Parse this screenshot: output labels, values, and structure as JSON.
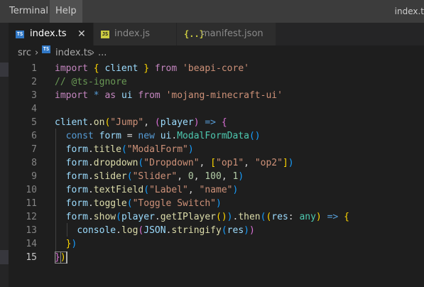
{
  "menubar": {
    "items": [
      {
        "label": "Terminal",
        "active": false
      },
      {
        "label": "Help",
        "active": true
      }
    ],
    "window_title": "index.t"
  },
  "tabs": [
    {
      "label": "index.ts",
      "icon": "ts-file-icon",
      "icon_text": "TS",
      "active": true,
      "closable": true,
      "close_glyph": "✕"
    },
    {
      "label": "index.js",
      "icon": "js-file-icon",
      "icon_text": "JS",
      "active": false
    },
    {
      "label": "manifest.json",
      "icon": "json-file-icon",
      "icon_text": "{..}",
      "active": false
    }
  ],
  "breadcrumb": {
    "folder": "src",
    "separator": "›",
    "file": "index.ts",
    "file_icon_text": "TS",
    "tail": "..."
  },
  "editor": {
    "current_line": 15,
    "colors": {
      "keyword": "#569cd6",
      "control": "#c586c0",
      "string": "#ce9178",
      "comment": "#6a9955",
      "variable": "#9cdcfe",
      "function": "#dcdcaa",
      "class": "#4ec9b0",
      "number": "#b5cea8"
    },
    "lines": [
      {
        "num": "1",
        "tokens": [
          [
            "tok-kw-ctl",
            "import"
          ],
          [
            "tok-plain",
            " "
          ],
          [
            "tok-br1",
            "{"
          ],
          [
            "tok-plain",
            " "
          ],
          [
            "tok-var",
            "client"
          ],
          [
            "tok-plain",
            " "
          ],
          [
            "tok-br1",
            "}"
          ],
          [
            "tok-plain",
            " "
          ],
          [
            "tok-kw-ctl",
            "from"
          ],
          [
            "tok-plain",
            " "
          ],
          [
            "tok-str",
            "'beapi-core'"
          ]
        ]
      },
      {
        "num": "2",
        "tokens": [
          [
            "tok-cmt",
            "// @ts-ignore"
          ]
        ]
      },
      {
        "num": "3",
        "tokens": [
          [
            "tok-kw-ctl",
            "import"
          ],
          [
            "tok-plain",
            " "
          ],
          [
            "tok-kw-blue",
            "*"
          ],
          [
            "tok-plain",
            " "
          ],
          [
            "tok-kw-ctl",
            "as"
          ],
          [
            "tok-plain",
            " "
          ],
          [
            "tok-var",
            "ui"
          ],
          [
            "tok-plain",
            " "
          ],
          [
            "tok-kw-ctl",
            "from"
          ],
          [
            "tok-plain",
            " "
          ],
          [
            "tok-str",
            "'mojang-minecraft-ui'"
          ]
        ]
      },
      {
        "num": "4",
        "tokens": []
      },
      {
        "num": "5",
        "tokens": [
          [
            "tok-var",
            "client"
          ],
          [
            "tok-plain",
            "."
          ],
          [
            "tok-fn",
            "on"
          ],
          [
            "tok-br1",
            "("
          ],
          [
            "tok-str",
            "\"Jump\""
          ],
          [
            "tok-plain",
            ", "
          ],
          [
            "tok-br2",
            "("
          ],
          [
            "tok-var",
            "player"
          ],
          [
            "tok-br2",
            ")"
          ],
          [
            "tok-plain",
            " "
          ],
          [
            "tok-kw-blue",
            "=>"
          ],
          [
            "tok-plain",
            " "
          ],
          [
            "tok-br2",
            "{"
          ]
        ]
      },
      {
        "num": "6",
        "tokens": [
          [
            "tok-plain",
            "  "
          ],
          [
            "tok-kw-blue",
            "const"
          ],
          [
            "tok-plain",
            " "
          ],
          [
            "tok-var",
            "form"
          ],
          [
            "tok-plain",
            " = "
          ],
          [
            "tok-kw-blue",
            "new"
          ],
          [
            "tok-plain",
            " "
          ],
          [
            "tok-var",
            "ui"
          ],
          [
            "tok-plain",
            "."
          ],
          [
            "tok-cls",
            "ModalFormData"
          ],
          [
            "tok-br3",
            "()"
          ]
        ]
      },
      {
        "num": "7",
        "tokens": [
          [
            "tok-plain",
            "  "
          ],
          [
            "tok-var",
            "form"
          ],
          [
            "tok-plain",
            "."
          ],
          [
            "tok-fn",
            "title"
          ],
          [
            "tok-br3",
            "("
          ],
          [
            "tok-str",
            "\"ModalForm\""
          ],
          [
            "tok-br3",
            ")"
          ]
        ]
      },
      {
        "num": "8",
        "tokens": [
          [
            "tok-plain",
            "  "
          ],
          [
            "tok-var",
            "form"
          ],
          [
            "tok-plain",
            "."
          ],
          [
            "tok-fn",
            "dropdown"
          ],
          [
            "tok-br3",
            "("
          ],
          [
            "tok-str",
            "\"Dropdown\""
          ],
          [
            "tok-plain",
            ", "
          ],
          [
            "tok-br1",
            "["
          ],
          [
            "tok-str",
            "\"op1\""
          ],
          [
            "tok-plain",
            ", "
          ],
          [
            "tok-str",
            "\"op2\""
          ],
          [
            "tok-br1",
            "]"
          ],
          [
            "tok-br3",
            ")"
          ]
        ]
      },
      {
        "num": "9",
        "tokens": [
          [
            "tok-plain",
            "  "
          ],
          [
            "tok-var",
            "form"
          ],
          [
            "tok-plain",
            "."
          ],
          [
            "tok-fn",
            "slider"
          ],
          [
            "tok-br3",
            "("
          ],
          [
            "tok-str",
            "\"Slider\""
          ],
          [
            "tok-plain",
            ", "
          ],
          [
            "tok-num",
            "0"
          ],
          [
            "tok-plain",
            ", "
          ],
          [
            "tok-num",
            "100"
          ],
          [
            "tok-plain",
            ", "
          ],
          [
            "tok-num",
            "1"
          ],
          [
            "tok-br3",
            ")"
          ]
        ]
      },
      {
        "num": "10",
        "tokens": [
          [
            "tok-plain",
            "  "
          ],
          [
            "tok-var",
            "form"
          ],
          [
            "tok-plain",
            "."
          ],
          [
            "tok-fn",
            "textField"
          ],
          [
            "tok-br3",
            "("
          ],
          [
            "tok-str",
            "\"Label\""
          ],
          [
            "tok-plain",
            ", "
          ],
          [
            "tok-str",
            "\"name\""
          ],
          [
            "tok-br3",
            ")"
          ]
        ]
      },
      {
        "num": "11",
        "tokens": [
          [
            "tok-plain",
            "  "
          ],
          [
            "tok-var",
            "form"
          ],
          [
            "tok-plain",
            "."
          ],
          [
            "tok-fn",
            "toggle"
          ],
          [
            "tok-br3",
            "("
          ],
          [
            "tok-str",
            "\"Toggle Switch\""
          ],
          [
            "tok-br3",
            ")"
          ]
        ]
      },
      {
        "num": "12",
        "tokens": [
          [
            "tok-plain",
            "  "
          ],
          [
            "tok-var",
            "form"
          ],
          [
            "tok-plain",
            "."
          ],
          [
            "tok-fn",
            "show"
          ],
          [
            "tok-br3",
            "("
          ],
          [
            "tok-var",
            "player"
          ],
          [
            "tok-plain",
            "."
          ],
          [
            "tok-fn",
            "getIPlayer"
          ],
          [
            "tok-br1",
            "()"
          ],
          [
            "tok-br3",
            ")"
          ],
          [
            "tok-plain",
            "."
          ],
          [
            "tok-fn",
            "then"
          ],
          [
            "tok-br3",
            "("
          ],
          [
            "tok-br1",
            "("
          ],
          [
            "tok-var",
            "res"
          ],
          [
            "tok-plain",
            ": "
          ],
          [
            "tok-type",
            "any"
          ],
          [
            "tok-br1",
            ")"
          ],
          [
            "tok-plain",
            " "
          ],
          [
            "tok-kw-blue",
            "=>"
          ],
          [
            "tok-plain",
            " "
          ],
          [
            "tok-br1",
            "{"
          ]
        ]
      },
      {
        "num": "13",
        "tokens": [
          [
            "tok-plain",
            "    "
          ],
          [
            "tok-var",
            "console"
          ],
          [
            "tok-plain",
            "."
          ],
          [
            "tok-fn",
            "log"
          ],
          [
            "tok-br2",
            "("
          ],
          [
            "tok-var",
            "JSON"
          ],
          [
            "tok-plain",
            "."
          ],
          [
            "tok-fn",
            "stringify"
          ],
          [
            "tok-br3",
            "("
          ],
          [
            "tok-var",
            "res"
          ],
          [
            "tok-br3",
            ")"
          ],
          [
            "tok-br2",
            ")"
          ]
        ]
      },
      {
        "num": "14",
        "tokens": [
          [
            "tok-plain",
            "  "
          ],
          [
            "tok-br1",
            "}"
          ],
          [
            "tok-br3",
            ")"
          ]
        ]
      },
      {
        "num": "15",
        "tokens": [
          [
            "tok-br2",
            "}"
          ],
          [
            "tok-br1",
            ")"
          ]
        ]
      }
    ]
  }
}
